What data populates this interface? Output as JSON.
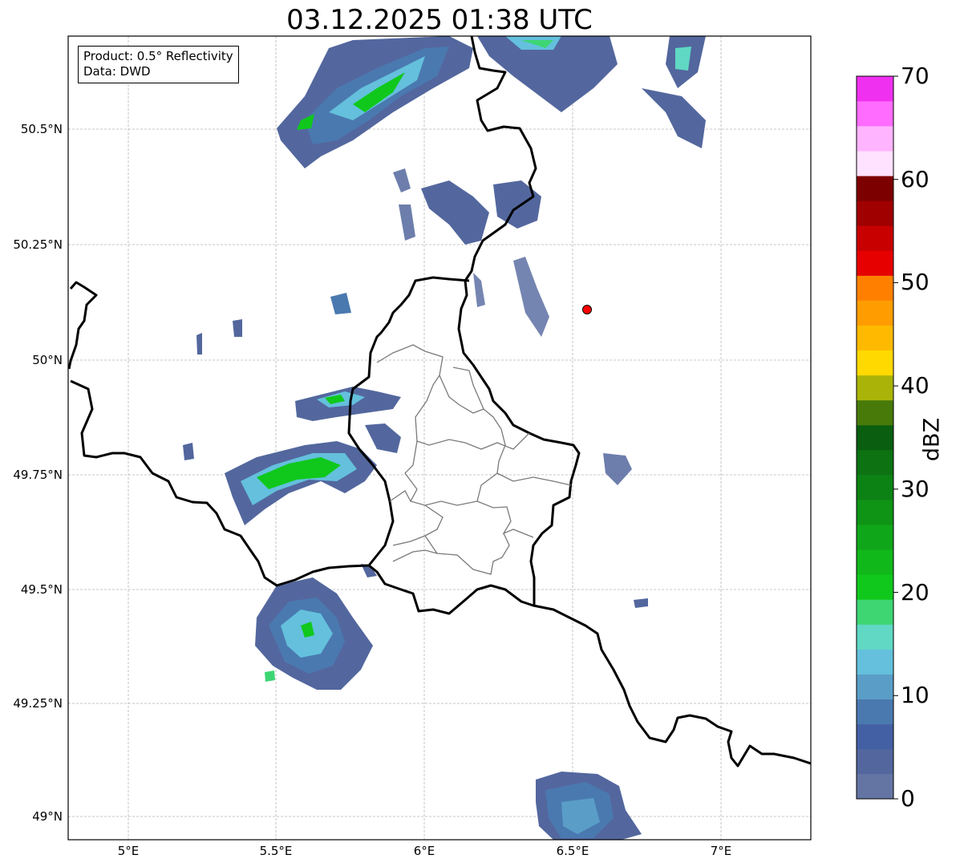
{
  "title": "03.12.2025 01:38 UTC",
  "info_box": {
    "line1": "Product: 0.5° Reflectivity",
    "line2": "Data: DWD"
  },
  "x_ticks": [
    "5°E",
    "5.5°E",
    "6°E",
    "6.5°E",
    "7°E"
  ],
  "y_ticks": [
    "50.5°N",
    "50.25°N",
    "50°N",
    "49.75°N",
    "49.5°N",
    "49.25°N",
    "49°N"
  ],
  "colorbar": {
    "label": "dBZ",
    "ticks": [
      "0",
      "10",
      "20",
      "30",
      "40",
      "50",
      "60",
      "70"
    ],
    "colors": [
      "#6475a4",
      "#53679e",
      "#4460a4",
      "#4a79b0",
      "#5a9ec7",
      "#64c0dc",
      "#60d8c4",
      "#3dd673",
      "#10c81c",
      "#10b81a",
      "#10a61a",
      "#0f9416",
      "#0d8214",
      "#0c7212",
      "#0a5e0f",
      "#487a0a",
      "#aab408",
      "#ffd900",
      "#ffba00",
      "#ff9d00",
      "#ff8000",
      "#e60000",
      "#c80000",
      "#a00000",
      "#7d0000",
      "#ffe2ff",
      "#ffb4ff",
      "#ff6cff",
      "#f030f0"
    ]
  },
  "marker": {
    "lon": 6.55,
    "lat": 50.11,
    "color": "#ff0000"
  }
}
